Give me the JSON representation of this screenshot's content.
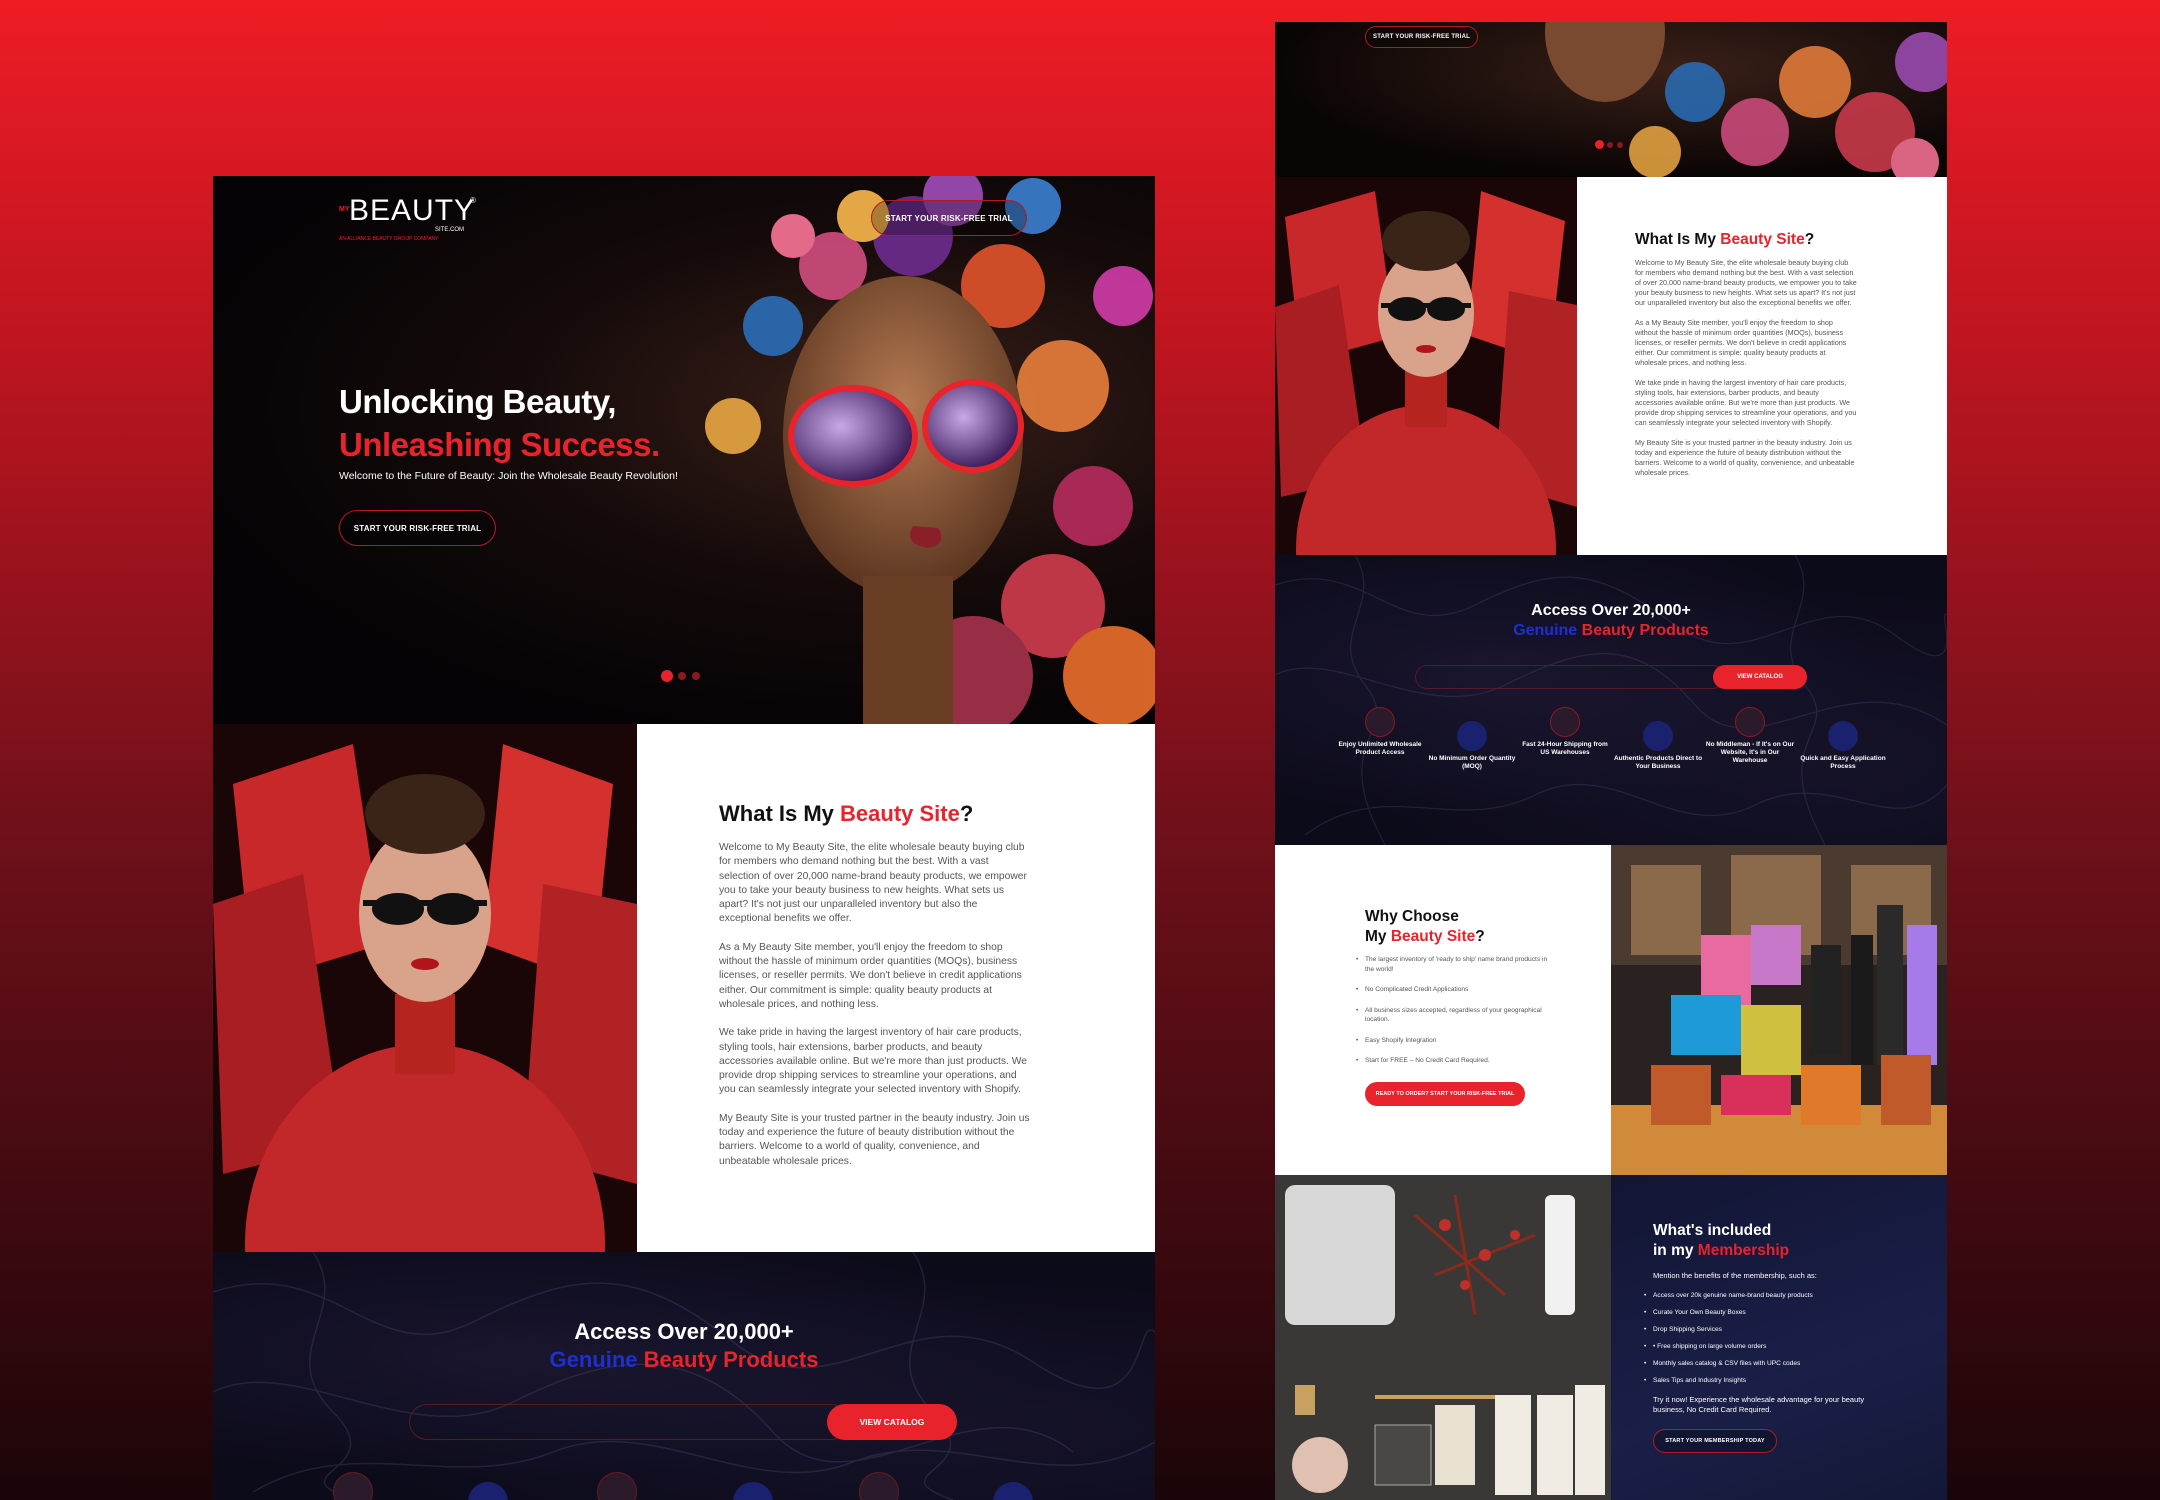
{
  "colors": {
    "accent": "#e8232b",
    "genuine_blue": "#1f2fd0",
    "dark_bg": "#0c0b1a",
    "navy": "#121533"
  },
  "left": {
    "logo": {
      "my": "MY",
      "brand": "BEAUTY",
      "sub": "SITE.COM",
      "tag": "AN ALLIANCE BEAUTY GROUP COMPANY",
      "reg": "®"
    },
    "header_cta": "START YOUR RISK-FREE TRIAL",
    "hero": {
      "line1": "Unlocking Beauty,",
      "line2": "Unleashing Success.",
      "subtitle": "Welcome to the Future of Beauty: Join the Wholesale Beauty Revolution!",
      "cta": "START YOUR RISK-FREE TRIAL"
    },
    "about": {
      "title_pre": "What Is My ",
      "title_accent": "Beauty Site",
      "title_post": "?",
      "p1": "Welcome to My Beauty Site, the elite wholesale beauty buying club for members who demand nothing but the best. With a vast selection of over 20,000 name-brand beauty products, we empower you to take your beauty business to new heights. What sets us apart? It's not just our unparalleled inventory but also the exceptional benefits we offer.",
      "p2": "As a My Beauty Site member, you'll enjoy the freedom to shop without the hassle of minimum order quantities (MOQs), business licenses, or reseller permits. We don't believe in credit applications either. Our commitment is simple: quality beauty products at wholesale prices, and nothing less.",
      "p3": "We take pride in having the largest inventory of hair care products, styling tools, hair extensions, barber products, and beauty accessories available online. But we're more than just products. We provide drop shipping services to streamline your operations, and you can seamlessly integrate your selected inventory with Shopify.",
      "p4": "My Beauty Site is your trusted partner in the beauty industry. Join us today and experience the future of beauty distribution without the barriers. Welcome to a world of quality, convenience, and unbeatable wholesale prices."
    },
    "access": {
      "line1": "Access Over 20,000+",
      "genuine": "Genuine",
      "accent": "Beauty Products",
      "cta": "VIEW CATALOG"
    }
  },
  "right": {
    "top_cta": "START YOUR RISK-FREE TRIAL",
    "about": {
      "title_pre": "What Is My ",
      "title_accent": "Beauty Site",
      "title_post": "?",
      "p1": "Welcome to My Beauty Site, the elite wholesale beauty buying club for members who demand nothing but the best. With a vast selection of over 20,000 name-brand beauty products, we empower you to take your beauty business to new heights. What sets us apart? It's not just our unparalleled inventory but also the exceptional benefits we offer.",
      "p2": "As a My Beauty Site member, you'll enjoy the freedom to shop without the hassle of minimum order quantities (MOQs), business licenses, or reseller permits. We don't believe in credit applications either. Our commitment is simple: quality beauty products at wholesale prices, and nothing less.",
      "p3": "We take pride in having the largest inventory of hair care products, styling tools, hair extensions, barber products, and beauty accessories available online. But we're more than just products. We provide drop shipping services to streamline your operations, and you can seamlessly integrate your selected inventory with Shopify.",
      "p4": "My Beauty Site is your trusted partner in the beauty industry. Join us today and experience the future of beauty distribution without the barriers. Welcome to a world of quality, convenience, and unbeatable wholesale prices."
    },
    "access": {
      "line1": "Access Over 20,000+",
      "genuine": "Genuine",
      "accent": "Beauty Products",
      "cta": "VIEW CATALOG"
    },
    "features": [
      {
        "label": "Enjoy Unlimited Wholesale Product Access",
        "icon": "box-icon"
      },
      {
        "label": "No Minimum Order Quantity (MOQ)",
        "icon": "cart-icon"
      },
      {
        "label": "Fast 24-Hour Shipping from US Warehouses",
        "icon": "truck-icon"
      },
      {
        "label": "Authentic Products Direct to Your Business",
        "icon": "badge-icon"
      },
      {
        "label": "No Middleman - If It's on Our Website, It's in Our Warehouse",
        "icon": "warehouse-icon"
      },
      {
        "label": "Quick and Easy Application Process",
        "icon": "clipboard-icon"
      }
    ],
    "why": {
      "line1": "Why Choose",
      "pre": "My ",
      "accent": "Beauty Site",
      "post": "?",
      "items": [
        "The largest inventory of 'ready to ship' name brand products in the world!",
        "No Complicated Credit Applications",
        "All business sizes accepted, regardless of your geographical location.",
        "Easy Shopify Integration",
        "Start for FREE – No Credit Card Required."
      ],
      "cta": "READY TO ORDER? START YOUR RISK-FREE TRIAL"
    },
    "membership": {
      "line1": "What's included",
      "pre": "in my ",
      "accent": "Membership",
      "intro": "Mention the benefits of the membership, such as:",
      "items": [
        "Access over 20k genuine name-brand beauty products",
        "Curate Your Own Beauty Boxes",
        "Drop Shipping Services",
        "• Free shipping on large volume orders",
        "Monthly sales catalog & CSV files with UPC codes",
        "Sales Tips and Industry Insights"
      ],
      "outro": "Try it now! Experience the wholesale advantage for your beauty business, No Credit Card Required.",
      "cta": "START YOUR MEMBERSHIP TODAY"
    }
  }
}
